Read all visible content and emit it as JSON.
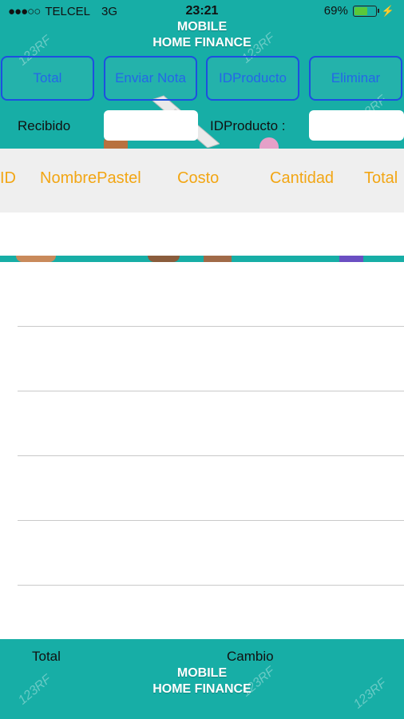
{
  "status": {
    "carrier": "TELCEL",
    "network": "3G",
    "time": "23:21",
    "battery": "69%",
    "battery_level": 0.69
  },
  "brand": {
    "line1": "MOBILE",
    "line2": "HOME FINANCE"
  },
  "watermark": "123RF",
  "toolbar": {
    "total_label": "Total",
    "enviar_label": "Enviar Nota",
    "idproducto_label": "IDProducto",
    "eliminar_label": "Eliminar"
  },
  "form": {
    "recibido_label": "Recibido",
    "recibido_value": "",
    "idproducto_label": "IDProducto :",
    "idproducto_value": ""
  },
  "table": {
    "columns": [
      "ID",
      "NombrePastel",
      "Costo",
      "Cantidad",
      "Total"
    ]
  },
  "footer": {
    "total_label": "Total",
    "cambio_label": "Cambio",
    "line1": "MOBILE",
    "line2": "HOME FINANCE"
  },
  "colors": {
    "teal": "#17aea6",
    "button_blue": "#1d4fe0",
    "header_orange": "#f2a614",
    "battery_green": "#5ac83a"
  }
}
